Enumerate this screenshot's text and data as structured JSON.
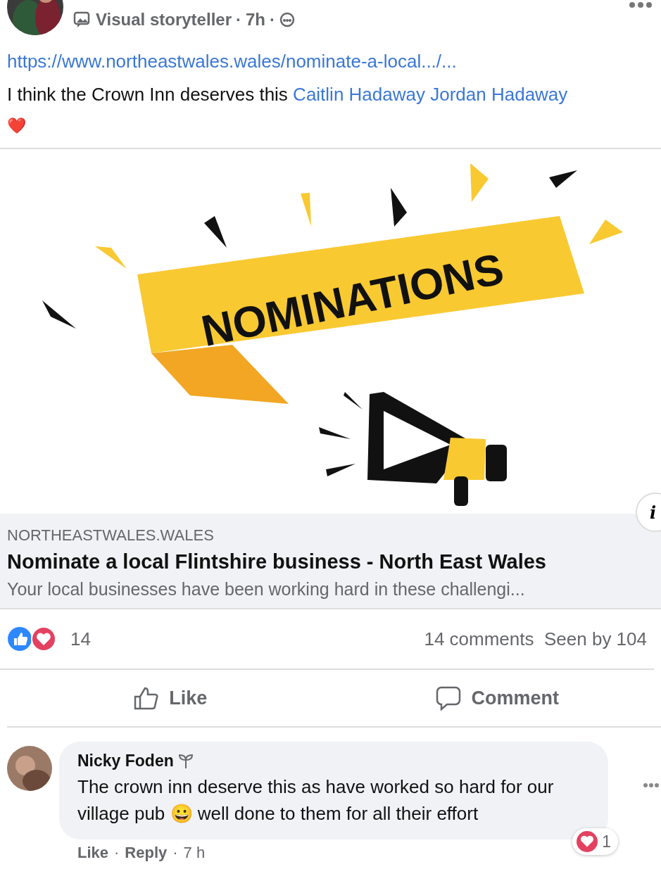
{
  "post": {
    "badge": "Visual storyteller",
    "time": "7h",
    "link": "https://www.northeastwales.wales/nominate-a-local.../...",
    "text": "I think the Crown Inn deserves this",
    "tags": [
      "Caitlin Hadaway",
      "Jordan Hadaway"
    ],
    "emoji": "❤️",
    "separator": "·"
  },
  "link_preview": {
    "image_text": "NOMINATIONS",
    "info": "i",
    "domain": "NORTHEASTWALES.WALES",
    "title": "Nominate a local Flintshire business - North East Wales",
    "description": "Your local businesses have been working hard in these challengi..."
  },
  "stats": {
    "reactions": "14",
    "comments": "14 comments",
    "seen": "Seen by 104"
  },
  "actions": [
    {
      "kind": "like",
      "label": "Like"
    },
    {
      "kind": "comment",
      "label": "Comment"
    }
  ],
  "comments": [
    {
      "author": "Nicky Foden",
      "text_before": "The crown inn deserve this as have worked so hard for our village pub",
      "emoji": "😀",
      "text_after": "well done to them for all their effort",
      "like": "Like",
      "reply": "Reply",
      "separator": "·",
      "time": "7 h",
      "reactions": "1"
    }
  ]
}
